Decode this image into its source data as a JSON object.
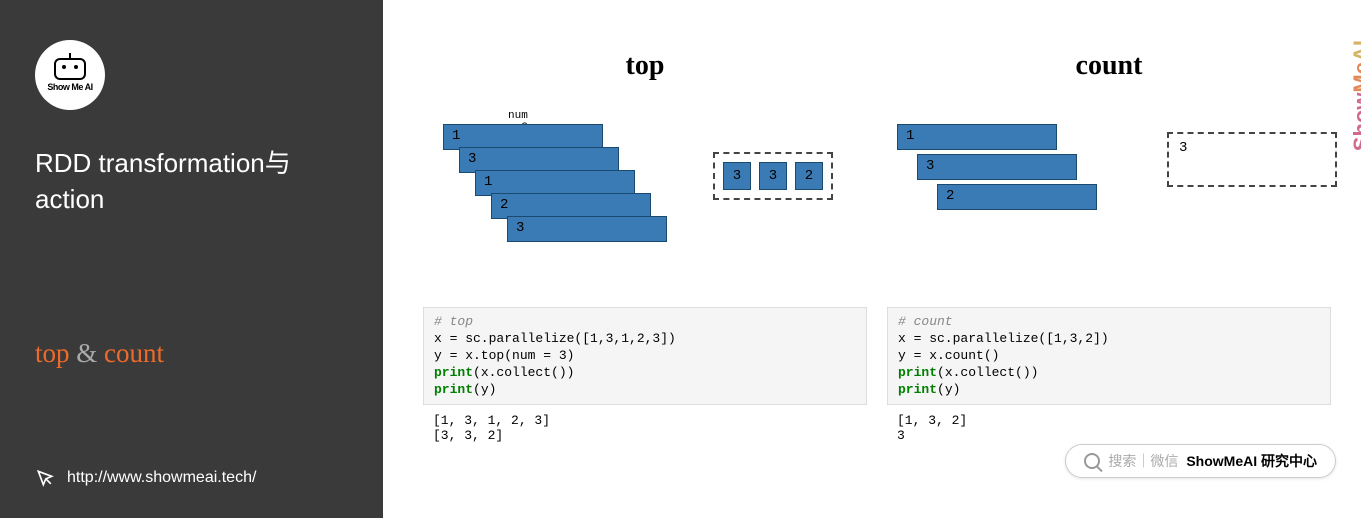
{
  "sidebar": {
    "logo_text": "Show Me AI",
    "title": "RDD transformation与action",
    "subtitle_top": "top",
    "subtitle_amp": "&",
    "subtitle_count": "count",
    "url": "http://www.showmeai.tech/"
  },
  "top": {
    "title": "top",
    "num_label": "num = 3",
    "cards": [
      "1",
      "3",
      "1",
      "2",
      "3"
    ],
    "results": [
      "3",
      "3",
      "2"
    ],
    "code_comment": "# top",
    "code_line1": "x = sc.parallelize([1,3,1,2,3])",
    "code_line2": "y = x.top(num = 3)",
    "code_line3_kw": "print",
    "code_line3_rest": "(x.collect())",
    "code_line4_kw": "print",
    "code_line4_rest": "(y)",
    "output": "[1, 3, 1, 2, 3]\n[3, 3, 2]"
  },
  "count": {
    "title": "count",
    "cards": [
      "1",
      "3",
      "2"
    ],
    "result": "3",
    "code_comment": "# count",
    "code_line1": "x = sc.parallelize([1,3,2])",
    "code_line2": "y = x.count()",
    "code_line3_kw": "print",
    "code_line3_rest": "(x.collect())",
    "code_line4_kw": "print",
    "code_line4_rest": "(y)",
    "output": "[1, 3, 2]\n3"
  },
  "watermark": "ShowMeAI",
  "search": {
    "hint": "搜索｜微信",
    "strong": "ShowMeAI 研究中心"
  }
}
